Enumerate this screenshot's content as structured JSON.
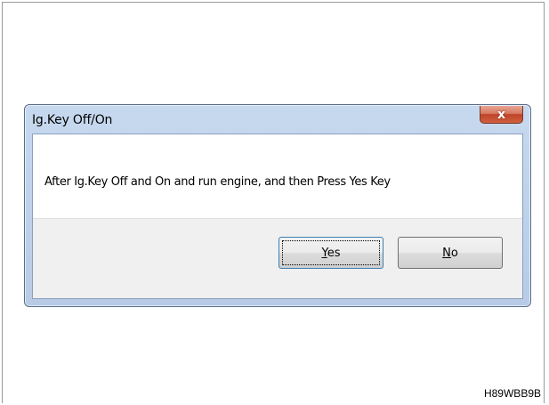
{
  "dialog": {
    "title": "Ig.Key Off/On",
    "close_glyph": "x",
    "message": "After Ig.Key Off and On and run engine, and then Press Yes Key",
    "buttons": {
      "yes_label": "Yes",
      "no_label": "No"
    }
  },
  "figure_code": "H89WBB9B",
  "icons": [
    "close-icon"
  ],
  "colors": {
    "titlebar": "#c7d9ef",
    "close_button": "#c0442a",
    "button_face": "#e5e5e5",
    "default_button_border": "#3c7fb1"
  }
}
